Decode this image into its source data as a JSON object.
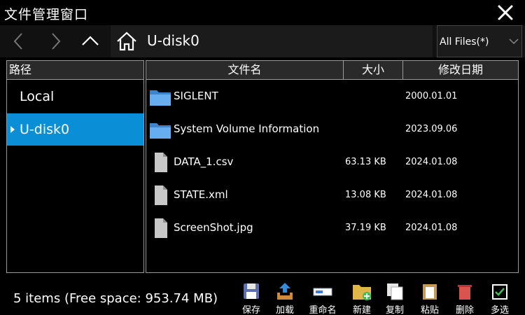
{
  "window": {
    "title": "文件管理窗口"
  },
  "navigation": {
    "path": "U-disk0",
    "filter": "All Files(*)"
  },
  "left_panel": {
    "header": "路径",
    "items": [
      {
        "label": "Local",
        "selected": false
      },
      {
        "label": "U-disk0",
        "selected": true
      }
    ]
  },
  "file_list": {
    "columns": [
      "文件名",
      "大小",
      "修改日期"
    ],
    "rows": [
      {
        "type": "folder",
        "name": "SIGLENT",
        "size": "",
        "date": "2000.01.01"
      },
      {
        "type": "folder",
        "name": "System Volume Information",
        "size": "",
        "date": "2023.09.06"
      },
      {
        "type": "file",
        "name": "DATA_1.csv",
        "size": "63.13 KB",
        "date": "2024.01.08"
      },
      {
        "type": "file",
        "name": "STATE.xml",
        "size": "13.08 KB",
        "date": "2024.01.08"
      },
      {
        "type": "file",
        "name": "ScreenShot.jpg",
        "size": "37.19 KB",
        "date": "2024.01.08"
      }
    ]
  },
  "status": {
    "text": "5 items (Free space: 953.74 MB)"
  },
  "toolbar": {
    "save": "保存",
    "load": "加载",
    "rename": "重命名",
    "new": "新建",
    "copy": "复制",
    "paste": "粘贴",
    "delete": "删除",
    "select": "多选"
  },
  "colors": {
    "selection": "#0a8fd6",
    "folder": "#4a90d9",
    "background": "#000000"
  }
}
